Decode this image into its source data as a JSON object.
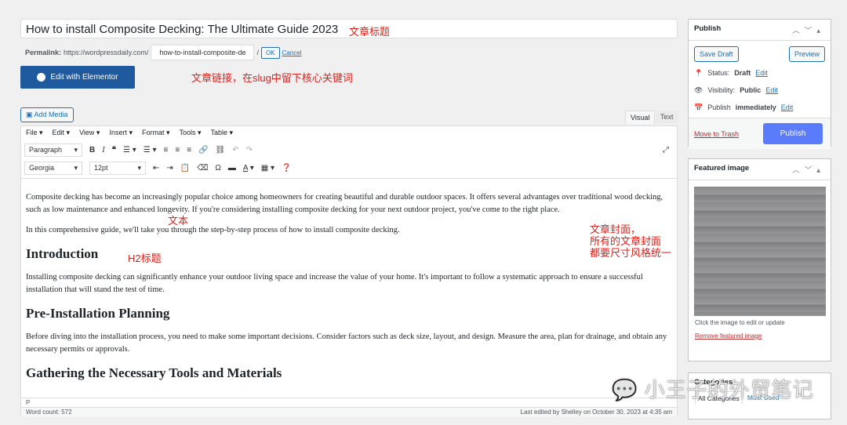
{
  "post": {
    "title": "How to install Composite Decking: The Ultimate Guide 2023",
    "permalink_label": "Permalink:",
    "permalink_base": "https://wordpressdaily.com/",
    "slug": "how-to-install-composite-de",
    "slash": "/",
    "ok": "OK",
    "cancel": "Cancel"
  },
  "annotations": {
    "title": "文章标题",
    "permalink": "文章链接，在slug中留下核心关键词",
    "text": "文本",
    "h2": "H2标题",
    "cover": [
      "文章封面，",
      "所有的文章封面",
      "都要尺寸风格统一"
    ]
  },
  "elementor": {
    "label": "Edit with Elementor"
  },
  "editor": {
    "add_media": "Add Media",
    "tab_visual": "Visual",
    "tab_text": "Text",
    "menus": [
      "File ▾",
      "Edit ▾",
      "View ▾",
      "Insert ▾",
      "Format ▾",
      "Tools ▾",
      "Table ▾"
    ],
    "block_format": "Paragraph",
    "font_family": "Georgia",
    "font_size": "12pt",
    "toolbar1_icons": [
      "bold-icon",
      "italic-icon",
      "blockquote-icon",
      "bullet-list-icon",
      "numbered-list-icon",
      "align-left-icon",
      "align-center-icon",
      "align-right-icon",
      "link-icon",
      "unlink-icon",
      "undo-icon",
      "redo-icon"
    ],
    "toolbar2_icons": [
      "outdent-icon",
      "indent-icon",
      "paste-text-icon",
      "clear-format-icon",
      "special-char-icon",
      "hr-icon",
      "text-color-icon",
      "table-icon",
      "help-icon"
    ]
  },
  "content": {
    "p1": "Composite decking has become an increasingly popular choice among homeowners for creating beautiful and durable outdoor spaces. It offers several advantages over traditional wood decking, such as low maintenance and enhanced longevity. If you're considering installing composite decking for your next outdoor project, you've come to the right place.",
    "p2": "In this comprehensive guide, we'll take you through the step-by-step process of how to install composite decking.",
    "h1": "Introduction",
    "p3": "Installing composite decking can significantly enhance your outdoor living space and increase the value of your home. It's important to follow a systematic approach to ensure a successful installation that will stand the test of time.",
    "h2": "Pre-Installation Planning",
    "p4": "Before diving into the installation process, you need to make some important decisions. Consider factors such as deck size, layout, and design. Measure the area, plan for drainage, and obtain any necessary permits or approvals.",
    "h3": "Gathering the Necessary Tools and Materials"
  },
  "statusbar": {
    "path": "P",
    "word_count": "Word count: 572",
    "last_edited": "Last edited by Shelley on October 30, 2023 at 4:35 am"
  },
  "publish": {
    "title": "Publish",
    "save_draft": "Save Draft",
    "preview": "Preview",
    "status_label": "Status:",
    "status": "Draft",
    "visibility_label": "Visibility:",
    "visibility": "Public",
    "schedule_label": "Publish",
    "schedule": "immediately",
    "edit": "Edit",
    "trash": "Move to Trash",
    "publish": "Publish"
  },
  "featured": {
    "title": "Featured image",
    "hint": "Click the image to edit or update",
    "remove": "Remove featured image"
  },
  "categories": {
    "title": "Categories",
    "tab_all": "All Categories",
    "tab_used": "Most Used"
  },
  "watermark": "小王子的外贸笔记",
  "colors": {
    "accent": "#2271b1",
    "publish": "#5b7cfa",
    "elementor": "#1f5a9e",
    "annotation": "#e0201b"
  }
}
